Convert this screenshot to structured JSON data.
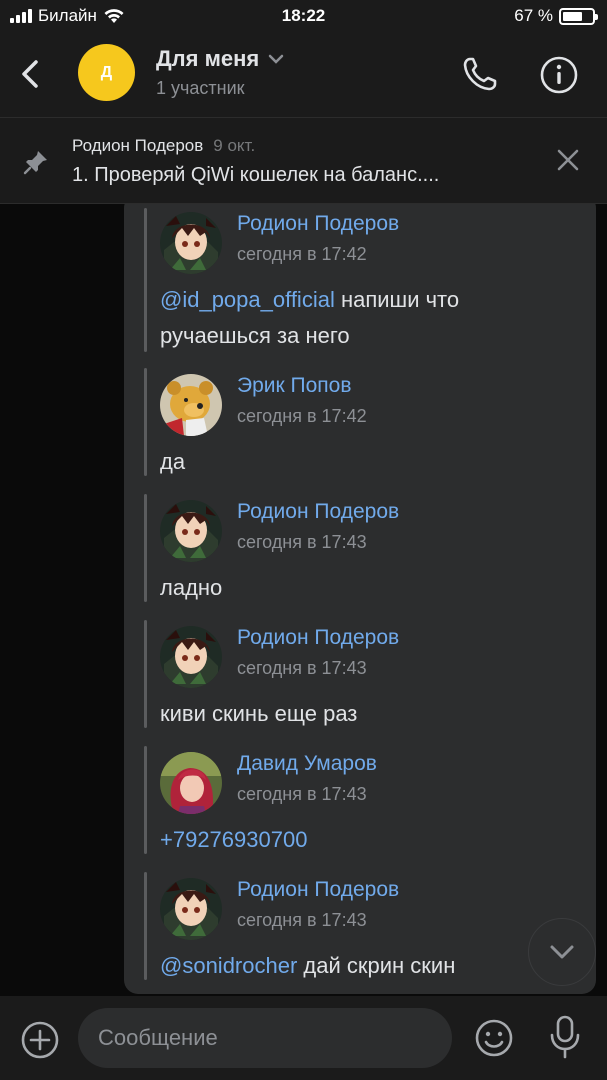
{
  "status_bar": {
    "carrier": "Билайн",
    "time": "18:22",
    "battery_percent_text": "67 %",
    "battery_level": 0.67
  },
  "header": {
    "avatar_letter": "Д",
    "title": "Для меня",
    "subtitle": "1 участник"
  },
  "pinned": {
    "author": "Родион Подеров",
    "date": "9 окт.",
    "text": "1. Проверяй QiWi кошелек на баланс...."
  },
  "messages": [
    {
      "author": "Родион Подеров",
      "time": "сегодня в 17:42",
      "mention": "@id_popa_official",
      "text": " напиши что",
      "text2": "ручаешься за него",
      "avatar": "tanjiro"
    },
    {
      "author": "Эрик Попов",
      "time": "сегодня в 17:42",
      "text": "да",
      "avatar": "pooh"
    },
    {
      "author": "Родион Подеров",
      "time": "сегодня в 17:43",
      "text": "ладно",
      "avatar": "tanjiro"
    },
    {
      "author": "Родион Подеров",
      "time": "сегодня в 17:43",
      "text": "киви скинь еще раз",
      "avatar": "tanjiro"
    },
    {
      "author": "Давид Умаров",
      "time": "сегодня в 17:43",
      "link": "+79276930700",
      "avatar": "ariel"
    },
    {
      "author": "Родион Подеров",
      "time": "сегодня в 17:43",
      "mention": "@sonidrocher",
      "text": " дай скрин скин",
      "avatar": "tanjiro"
    }
  ],
  "composer": {
    "placeholder": "Сообщение"
  },
  "colors": {
    "accent": "#71aaeb",
    "avatar_yellow": "#f6c81d",
    "bubble": "#2c2d2e",
    "background": "#0a0a0a"
  },
  "icons": [
    "back-icon",
    "chevron-down-icon",
    "phone-icon",
    "info-icon",
    "pin-icon",
    "close-icon",
    "scroll-down-icon",
    "plus-icon",
    "emoji-icon",
    "microphone-icon"
  ]
}
